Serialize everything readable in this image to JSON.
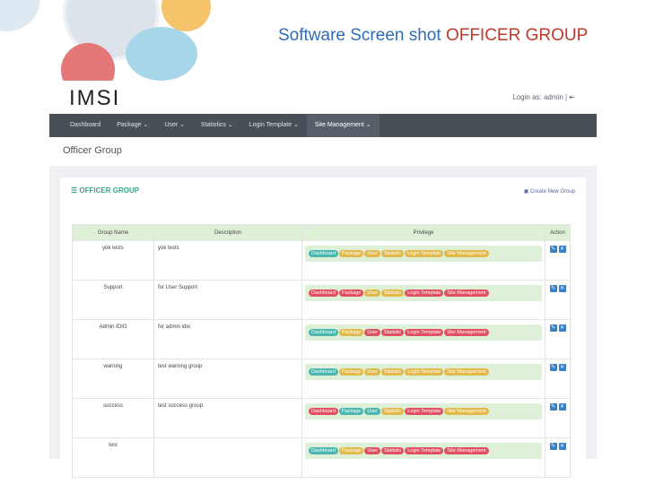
{
  "slide_title": {
    "part1": "Software Screen shot",
    "part2": "OFFICER GROUP"
  },
  "app": {
    "logo": "IMSI",
    "login": "Login as: admin"
  },
  "nav": [
    "Dashboard",
    "Package ⌄",
    "User ⌄",
    "Statistics ⌄",
    "Login Template ⌄",
    "Site Management ⌄"
  ],
  "page_title": "Officer Group",
  "card": {
    "title": "☰ OFFICER GROUP",
    "create": "Create New Group"
  },
  "columns": [
    "Group Name",
    "Description",
    "Privilege",
    "Action"
  ],
  "privileges": [
    "Dashboard",
    "Package",
    "User",
    "Statistic",
    "Login Template",
    "Site Management"
  ],
  "rows": [
    {
      "name": "yok tests",
      "desc": "yok tests",
      "status": [
        "t",
        "y",
        "y",
        "y",
        "y",
        "y"
      ]
    },
    {
      "name": "Support",
      "desc": "for User Support",
      "status": [
        "r",
        "r",
        "y",
        "y",
        "r",
        "r"
      ]
    },
    {
      "name": "Admin IDIO",
      "desc": "for admin idio",
      "status": [
        "t",
        "y",
        "r",
        "r",
        "r",
        "r"
      ]
    },
    {
      "name": "warning",
      "desc": "test warning group",
      "status": [
        "t",
        "y",
        "y",
        "y",
        "y",
        "y"
      ]
    },
    {
      "name": "success",
      "desc": "test success group",
      "status": [
        "r",
        "t",
        "t",
        "y",
        "r",
        "y"
      ]
    },
    {
      "name": "test",
      "desc": "",
      "status": [
        "t",
        "y",
        "r",
        "r",
        "r",
        "r"
      ]
    }
  ],
  "colors": {
    "t": "#4bb7b0",
    "y": "#e2b94a",
    "r": "#e05060"
  }
}
